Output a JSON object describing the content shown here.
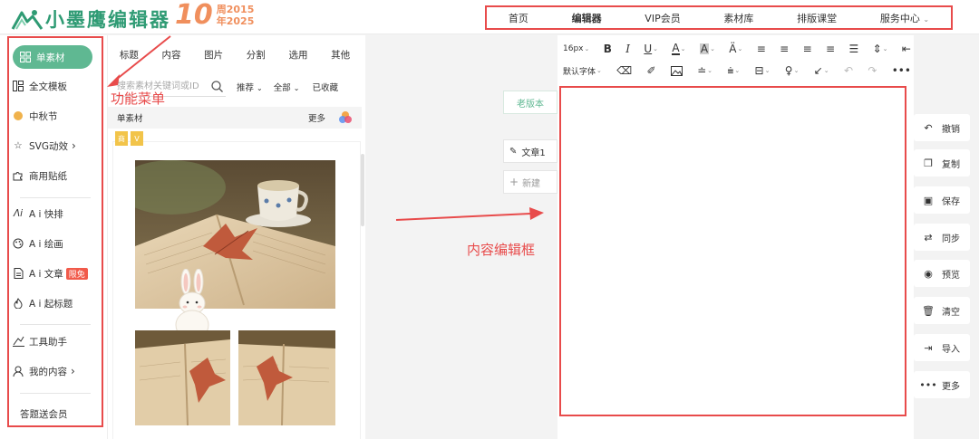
{
  "brand": {
    "name": "小墨鹰编辑器",
    "anniv_number": "10",
    "anniv_char": "周",
    "year_start": "2015",
    "year_prefix": "年",
    "year_end": "2025"
  },
  "nav": [
    "首页",
    "编辑器",
    "VIP会员",
    "素材库",
    "排版课堂",
    "服务中心"
  ],
  "nav_active_index": 1,
  "sidebar": {
    "items": [
      {
        "label": "单素材",
        "icon": "grid-icon"
      },
      {
        "label": "全文模板",
        "icon": "template-icon"
      },
      {
        "label": "中秋节",
        "icon": "dot-icon"
      },
      {
        "label": "SVG动效",
        "icon": "star-icon",
        "arrow": "›"
      },
      {
        "label": "商用贴纸",
        "icon": "puzzle-icon"
      },
      {
        "label": "A i 快排",
        "icon": "ai-icon"
      },
      {
        "label": "A i 绘画",
        "icon": "palette-icon"
      },
      {
        "label": "A i 文章",
        "icon": "doc-icon",
        "badge": "限免"
      },
      {
        "label": "A i 起标题",
        "icon": "fire-icon"
      },
      {
        "label": "工具助手",
        "icon": "tool-icon"
      },
      {
        "label": "我的内容",
        "icon": "user-icon",
        "arrow": "›"
      },
      {
        "label": "答题送会员",
        "icon": ""
      }
    ]
  },
  "panel": {
    "tabs": [
      "标题",
      "内容",
      "图片",
      "分割",
      "选用",
      "其他"
    ],
    "search_placeholder": "搜索素材关键词或ID",
    "filter_sort": "推荐",
    "filter_scope": "全部",
    "favorites": "已收藏",
    "section_label": "单素材",
    "more_label": "更多",
    "card_badges": [
      "商",
      "V"
    ]
  },
  "middle": {
    "old_version": "老版本",
    "article": "文章1",
    "new": "新建"
  },
  "toolbar": {
    "font_size": "16px",
    "font_family": "默认字体"
  },
  "actions": [
    {
      "label": "撤销",
      "icon": "undo-icon"
    },
    {
      "label": "复制",
      "icon": "copy-icon"
    },
    {
      "label": "保存",
      "icon": "save-icon"
    },
    {
      "label": "同步",
      "icon": "sync-icon"
    },
    {
      "label": "预览",
      "icon": "eye-icon"
    },
    {
      "label": "清空",
      "icon": "trash-icon"
    },
    {
      "label": "导入",
      "icon": "import-icon"
    },
    {
      "label": "更多",
      "icon": "more-icon"
    }
  ],
  "annotations": {
    "menu": "功能菜单",
    "editor": "内容编辑框"
  },
  "colors": {
    "brand_green": "#5fb892",
    "annotation_red": "#e84b4b",
    "anniv_orange": "#f08f5d"
  }
}
